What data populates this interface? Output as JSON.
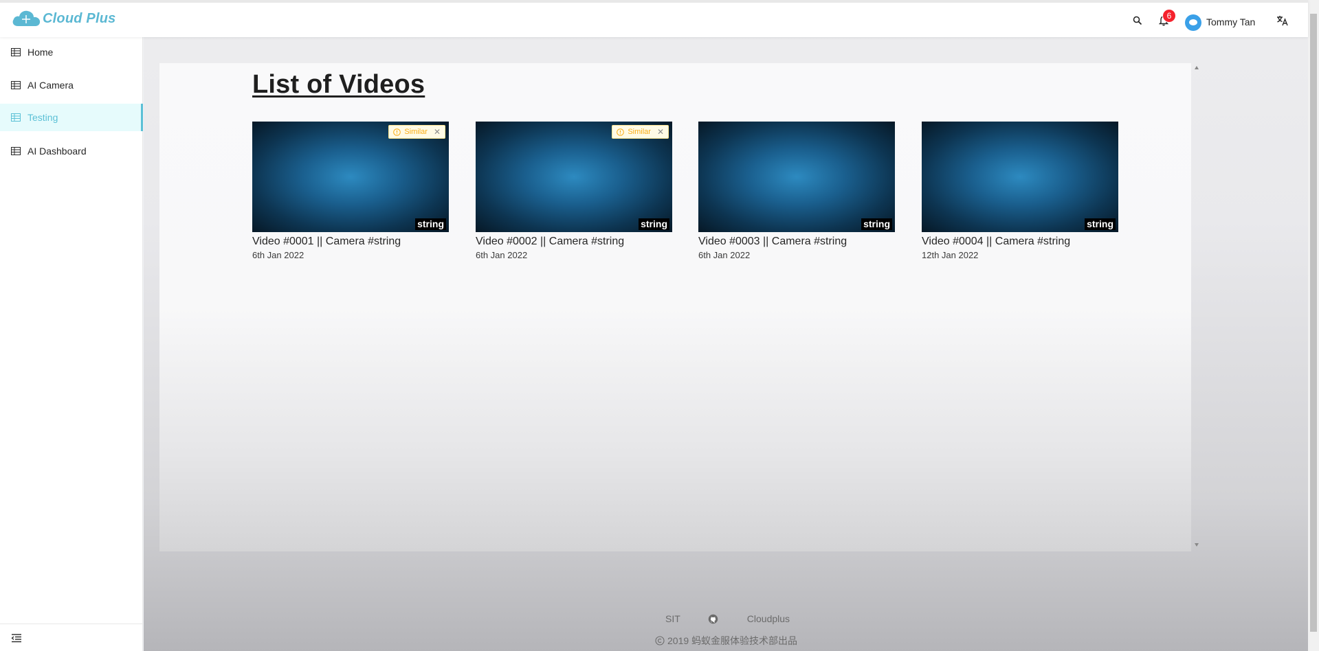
{
  "app": {
    "name": "Cloud Plus"
  },
  "header": {
    "notification_count": "6",
    "user_name": "Tommy Tan"
  },
  "sidebar": {
    "items": [
      {
        "label": "Home",
        "active": false
      },
      {
        "label": "AI Camera",
        "active": false
      },
      {
        "label": "Testing",
        "active": true
      },
      {
        "label": "AI Dashboard",
        "active": false
      }
    ]
  },
  "main": {
    "title": "List of Videos",
    "videos": [
      {
        "title": "Video #0001 || Camera #string",
        "date": "6th Jan 2022",
        "thumb_label": "string",
        "tag": "Similar"
      },
      {
        "title": "Video #0002 || Camera #string",
        "date": "6th Jan 2022",
        "thumb_label": "string",
        "tag": "Similar"
      },
      {
        "title": "Video #0003 || Camera #string",
        "date": "6th Jan 2022",
        "thumb_label": "string",
        "tag": null
      },
      {
        "title": "Video #0004 || Camera #string",
        "date": "12th Jan 2022",
        "thumb_label": "string",
        "tag": null
      }
    ]
  },
  "footer": {
    "links": [
      "SIT",
      "Cloudplus"
    ],
    "copyright": "2019 蚂蚁金服体验技术部出品"
  },
  "colors": {
    "brand": "#5bb8d3",
    "active": "#5bc0d6",
    "badge": "#f5222d",
    "tag": "#faad14"
  }
}
